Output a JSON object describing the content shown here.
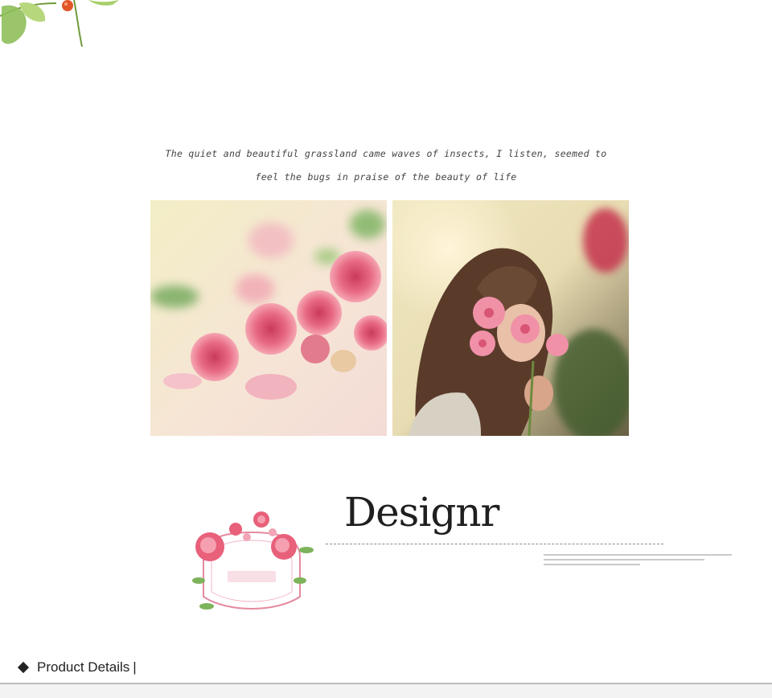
{
  "quote": {
    "line1": "The quiet and beautiful grassland came waves of insects, I listen, seemed to",
    "line2": "feel the bugs in praise of the beauty of life"
  },
  "images": {
    "left": "roses-photo",
    "right": "girl-with-flowers-photo",
    "corner": "leaf-branch-icon",
    "badge": "vintage-card-floral-badge"
  },
  "brand": {
    "title": "Designr"
  },
  "section": {
    "label": "Product Details",
    "separator": "|"
  },
  "colors": {
    "rose": "#e8607a",
    "cream": "#f4efc8",
    "leaf": "#7db35a",
    "berry": "#e2562a"
  }
}
